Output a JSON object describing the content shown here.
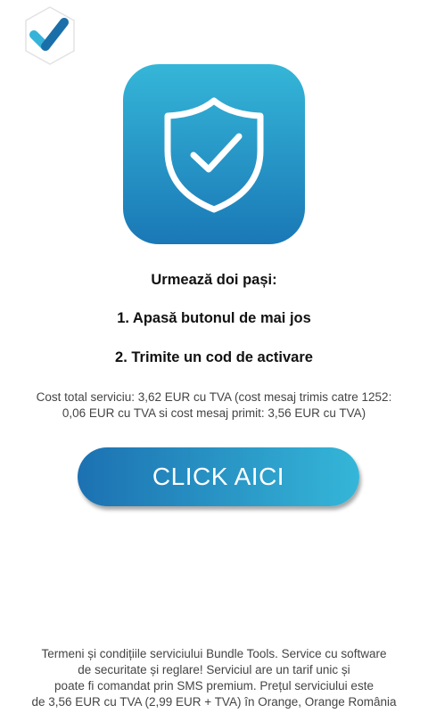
{
  "header": {
    "logo_icon": "checkmark-hexagon-logo"
  },
  "hero": {
    "icon": "shield-check-icon",
    "gradient_top": "#35b6d8",
    "gradient_bottom": "#1a78b6"
  },
  "instructions": {
    "title": "Urmează doi pași:",
    "step1": "1. Apasă butonul de mai jos",
    "step2": "2. Trimite un cod de activare"
  },
  "cost": {
    "line1": "Cost total serviciu: 3,62 EUR cu TVA (cost mesaj trimis catre 1252:",
    "line2": "0,06 EUR cu TVA si cost mesaj primit: 3,56 EUR cu TVA)"
  },
  "cta": {
    "label": "CLICK AICI"
  },
  "terms": {
    "line1": "Termeni și condițiile serviciului Bundle Tools. Service cu software",
    "line2": "de securitate și reglare! Serviciul are un tarif unic și",
    "line3": "poate fi comandat prin SMS premium. Prețul serviciului este",
    "line4": "de 3,56 EUR cu TVA (2,99 EUR + TVA) în Orange, Orange România"
  }
}
